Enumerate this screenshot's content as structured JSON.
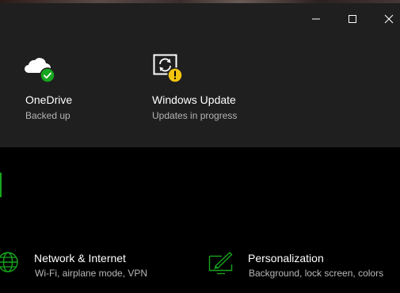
{
  "window": {
    "minimize_icon": "minimize-icon",
    "maximize_icon": "maximize-icon",
    "close_icon": "close-icon"
  },
  "status_tiles": [
    {
      "title": "OneDrive",
      "subtitle": "Backed up",
      "icon": "onedrive-cloud-icon",
      "badge": "check-badge",
      "badge_color": "#16a51e"
    },
    {
      "title": "Windows Update",
      "subtitle": "Updates in progress",
      "icon": "windows-update-icon",
      "badge": "warning-badge",
      "badge_color": "#f2c40f"
    }
  ],
  "categories": [
    {
      "title": "Network & Internet",
      "subtitle": "Wi-Fi, airplane mode, VPN",
      "icon": "globe-icon"
    },
    {
      "title": "Personalization",
      "subtitle": "Background, lock screen, colors",
      "icon": "personalization-icon"
    }
  ],
  "colors": {
    "accent": "#16a51e",
    "header_bg": "#1f1f1f",
    "page_bg": "#000000",
    "warning": "#f2c40f"
  }
}
